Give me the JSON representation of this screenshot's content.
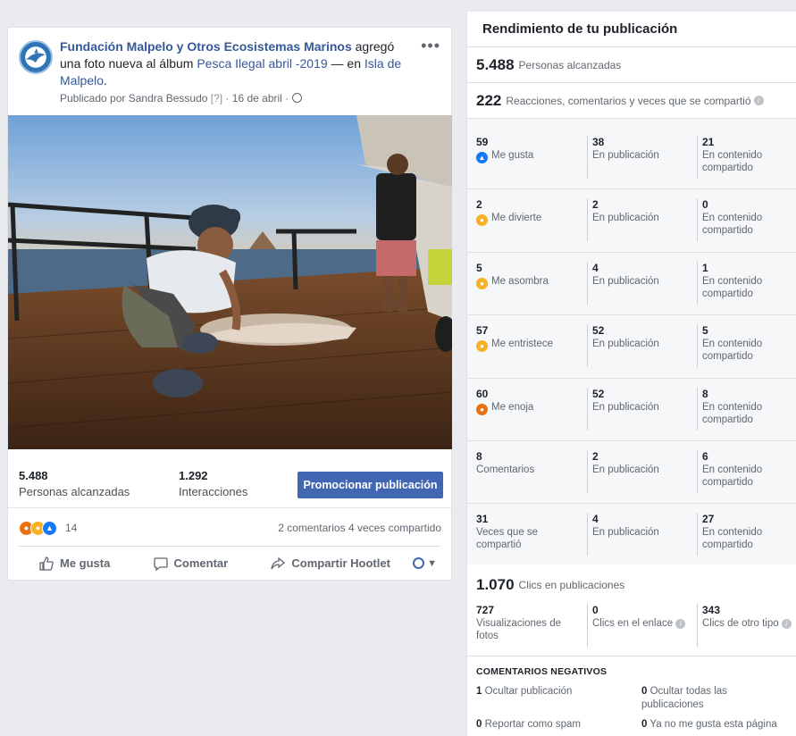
{
  "post": {
    "page_name": "Fundación Malpelo y Otros Ecosistemas Marinos",
    "action_text": " agregó una foto nueva al álbum ",
    "album": "Pesca Ilegal abril -2019",
    "sep": " — en ",
    "place": "Isla de Malpelo",
    "period": ".",
    "meta_author": "Publicado por Sandra Bessudo",
    "meta_tag": " [?]",
    "meta_date": " · 16 de abril · ",
    "more_icon": "more-dots-icon",
    "reach_num": "5.488",
    "reach_label": "Personas alcanzadas",
    "inter_num": "1.292",
    "inter_label": "Interacciones",
    "promote_label": "Promocionar publicación",
    "reactions_count": "14",
    "comments_shares": "2 comentarios  4 veces compartido",
    "like_label": "Me gusta",
    "comment_label": "Comentar",
    "share_label": "Compartir Hootlet"
  },
  "panel": {
    "title": "Rendimiento de tu publicación",
    "reach_num": "5.488",
    "reach_label": "Personas alcanzadas",
    "eng_num": "222",
    "eng_label": "Reacciones, comentarios y veces que se compartió",
    "rows": [
      {
        "n1": "59",
        "l1": "Me gusta",
        "emo": "like",
        "n2": "38",
        "l2": "En publicación",
        "n3": "21",
        "l3": "En contenido compartido"
      },
      {
        "n1": "2",
        "l1": "Me divierte",
        "emo": "haha",
        "n2": "2",
        "l2": "En publicación",
        "n3": "0",
        "l3": "En contenido compartido"
      },
      {
        "n1": "5",
        "l1": "Me asombra",
        "emo": "wow",
        "n2": "4",
        "l2": "En publicación",
        "n3": "1",
        "l3": "En contenido compartido"
      },
      {
        "n1": "57",
        "l1": "Me entristece",
        "emo": "sad",
        "n2": "52",
        "l2": "En publicación",
        "n3": "5",
        "l3": "En contenido compartido"
      },
      {
        "n1": "60",
        "l1": "Me enoja",
        "emo": "angry",
        "n2": "52",
        "l2": "En publicación",
        "n3": "8",
        "l3": "En contenido compartido"
      },
      {
        "n1": "8",
        "l1": "Comentarios",
        "emo": "",
        "n2": "2",
        "l2": "En publicación",
        "n3": "6",
        "l3": "En contenido compartido"
      },
      {
        "n1": "31",
        "l1": "Veces que se compartió",
        "emo": "",
        "n2": "4",
        "l2": "En publicación",
        "n3": "27",
        "l3": "En contenido compartido"
      }
    ],
    "clicks_num": "1.070",
    "clicks_label": "Clics en publicaciones",
    "c1_num": "727",
    "c1_label": "Visualizaciones de fotos",
    "c2_num": "0",
    "c2_label": "Clics en el enlace",
    "c3_num": "343",
    "c3_label": "Clics de otro tipo",
    "neg_title": "COMENTARIOS NEGATIVOS",
    "neg1_num": "1",
    "neg1_label": " Ocultar publicación",
    "neg2_num": "0",
    "neg2_label": " Ocultar todas las publicaciones",
    "neg3_num": "0",
    "neg3_label": " Reportar como spam",
    "neg4_num": "0",
    "neg4_label": " Ya no me gusta esta página"
  },
  "colors": {
    "brand": "#4267b2",
    "link": "#365899",
    "like": "#1877f2",
    "angry": "#e9710f",
    "yellow": "#f7b125"
  }
}
